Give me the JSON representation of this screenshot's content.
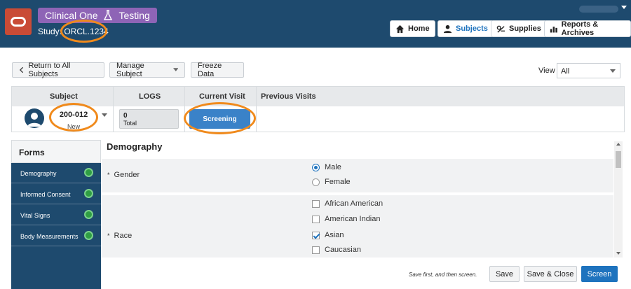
{
  "header": {
    "app_name": "Clinical One",
    "mode": "Testing",
    "study": "Study: ORCL.1234",
    "nav": [
      {
        "label": "Home",
        "icon": "home-icon"
      },
      {
        "label": "Subjects",
        "icon": "person-icon"
      },
      {
        "label": "Supplies",
        "icon": "supplies-icon"
      },
      {
        "label": "Reports & Archives",
        "icon": "bar-chart-icon"
      }
    ]
  },
  "toolbar": {
    "back_label": "Return to All Subjects",
    "manage_label": "Manage Subject",
    "freeze_label": "Freeze Data",
    "view_label": "View",
    "view_value": "All"
  },
  "subject_table": {
    "headers": [
      "Subject",
      "LOGS",
      "Current Visit",
      "Previous Visits"
    ],
    "subject_id": "200-012",
    "subject_status": "New",
    "logs_count": "0",
    "logs_caption": "Total",
    "current_visit": "Screening"
  },
  "forms": {
    "title": "Forms",
    "items": [
      "Demography",
      "Informed Consent",
      "Vital Signs",
      "Body Measurements"
    ]
  },
  "demography": {
    "title": "Demography",
    "gender_label": "Gender",
    "gender_options": [
      "Male",
      "Female"
    ],
    "gender_selected": "Male",
    "race_label": "Race",
    "race_options": [
      "African American",
      "American Indian",
      "Asian",
      "Caucasian"
    ],
    "race_selected": [
      "Asian"
    ],
    "required_mark": "*"
  },
  "actions": {
    "hint": "Save first, and then screen.",
    "save": "Save",
    "save_close": "Save & Close",
    "screen": "Screen"
  },
  "colors": {
    "header_bg": "#1e4a6e",
    "accent": "#1e73be",
    "highlight": "#f08a1c",
    "status_complete": "#2f9e44"
  }
}
